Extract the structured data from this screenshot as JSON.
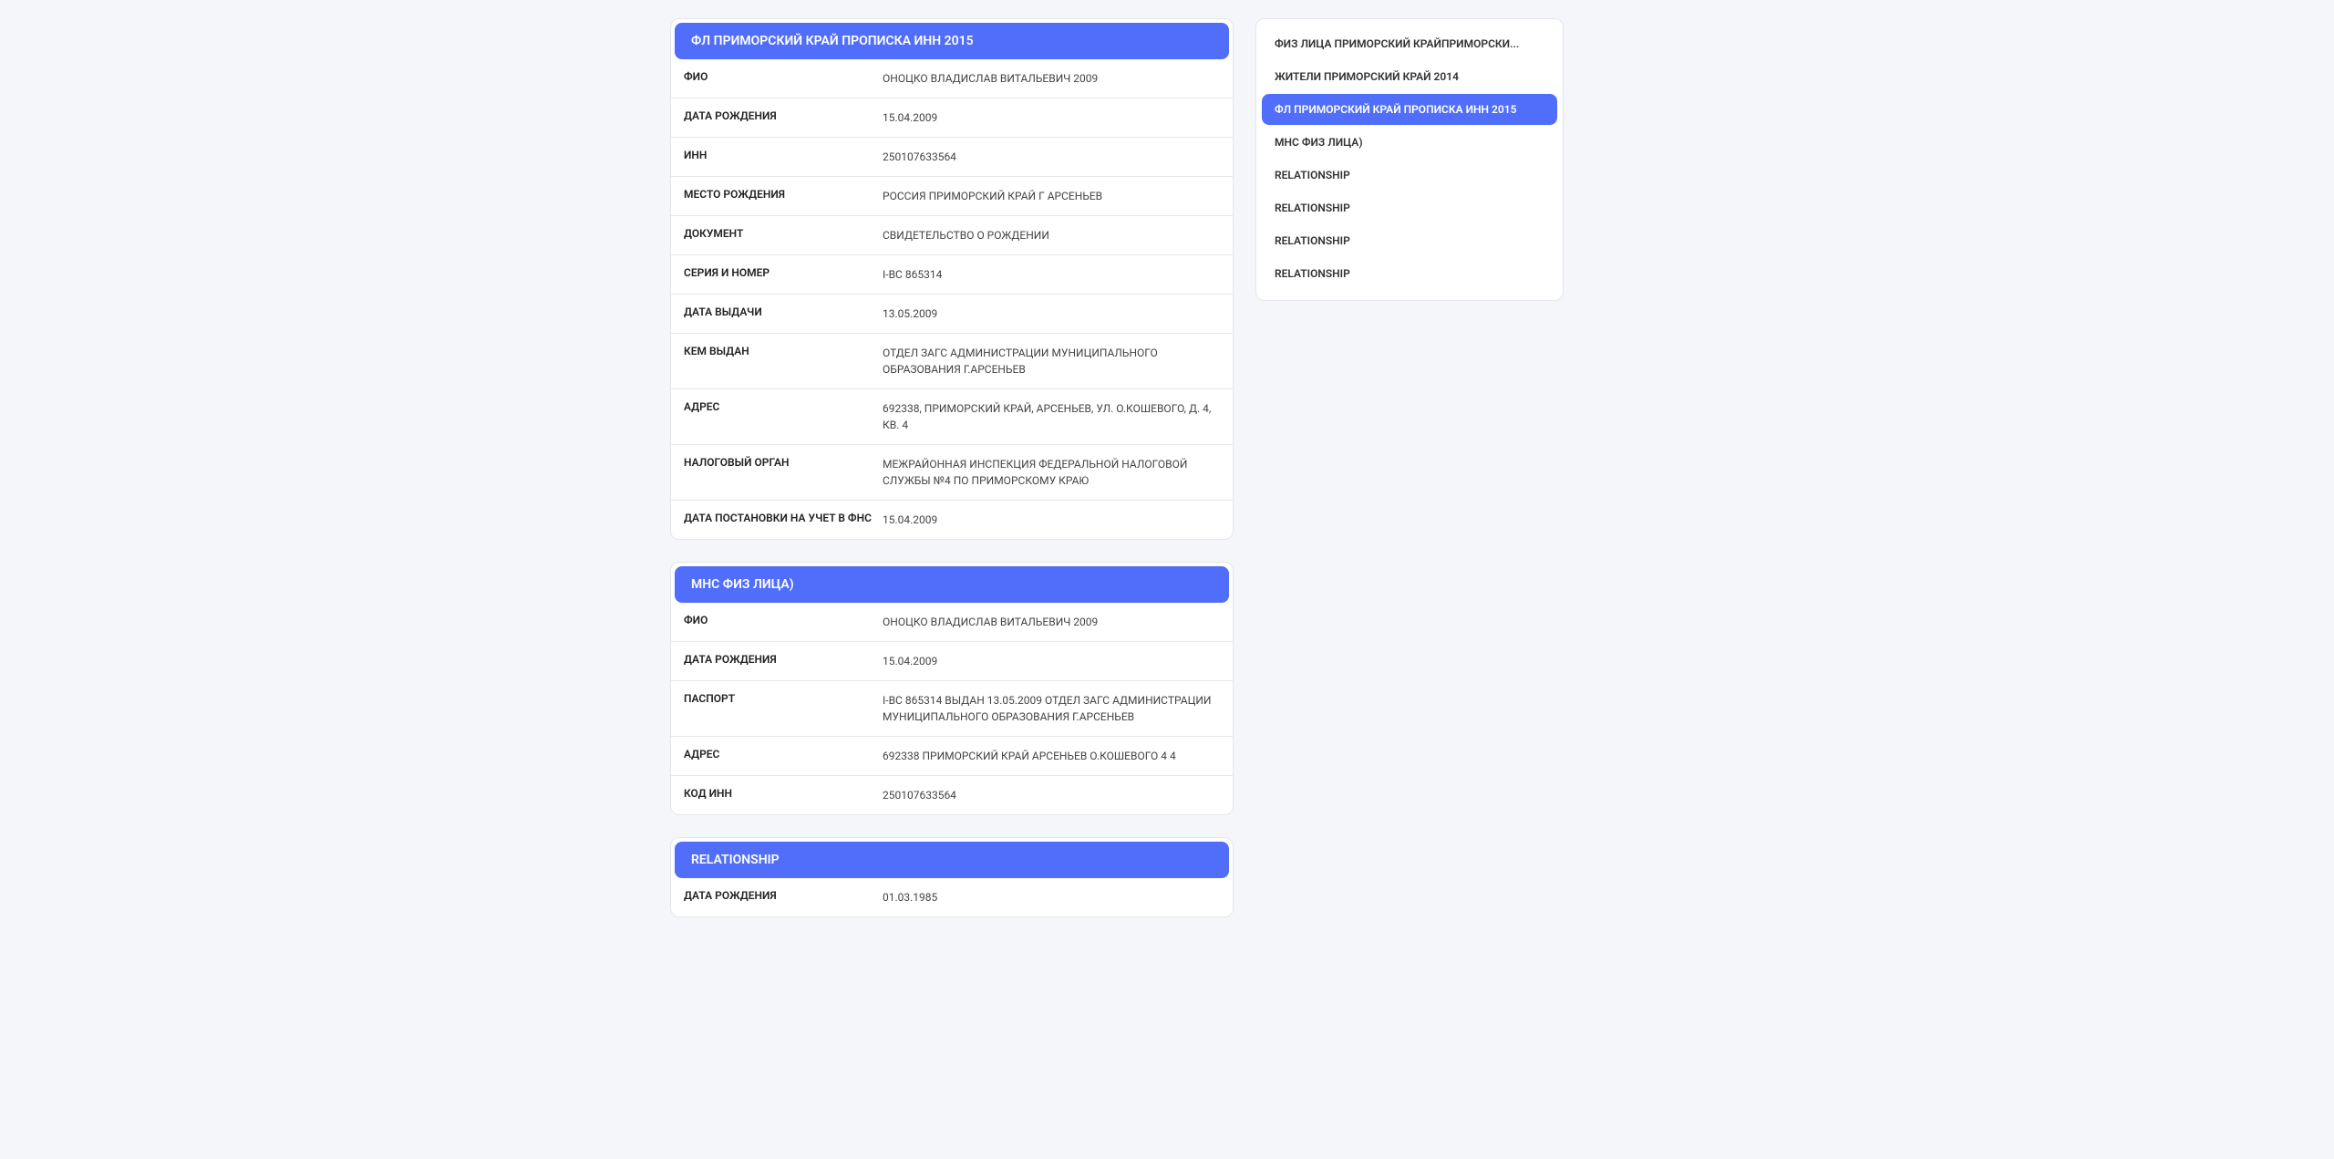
{
  "nav": {
    "items": [
      {
        "label": "ФИЗ ЛИЦА ПРИМОРСКИЙ КРАЙПРИМОРСКИ...",
        "active": false
      },
      {
        "label": "ЖИТЕЛИ ПРИМОРСКИЙ КРАЙ 2014",
        "active": false
      },
      {
        "label": "ФЛ ПРИМОРСКИЙ КРАЙ ПРОПИСКА ИНН 2015",
        "active": true
      },
      {
        "label": "МНС ФИЗ ЛИЦА)",
        "active": false
      },
      {
        "label": "RELATIONSHIP",
        "active": false
      },
      {
        "label": "RELATIONSHIP",
        "active": false
      },
      {
        "label": "RELATIONSHIP",
        "active": false
      },
      {
        "label": "RELATIONSHIP",
        "active": false
      }
    ]
  },
  "cards": [
    {
      "title": "ФЛ ПРИМОРСКИЙ КРАЙ ПРОПИСКА ИНН 2015",
      "rows": [
        {
          "label": "ФИО",
          "value": "ОНОЦКО ВЛАДИСЛАВ ВИТАЛЬЕВИЧ 2009"
        },
        {
          "label": "ДАТА РОЖДЕНИЯ",
          "value": "15.04.2009"
        },
        {
          "label": "ИНН",
          "value": "250107633564"
        },
        {
          "label": "МЕСТО РОЖДЕНИЯ",
          "value": "РОССИЯ ПРИМОРСКИЙ КРАЙ Г АРСЕНЬЕВ"
        },
        {
          "label": "ДОКУМЕНТ",
          "value": "СВИДЕТЕЛЬСТВО О РОЖДЕНИИ"
        },
        {
          "label": "СЕРИЯ И НОМЕР",
          "value": "I-ВС 865314"
        },
        {
          "label": "ДАТА ВЫДАЧИ",
          "value": "13.05.2009"
        },
        {
          "label": "КЕМ ВЫДАН",
          "value": "ОТДЕЛ ЗАГС АДМИНИСТРАЦИИ МУНИЦИПАЛЬНОГО ОБРАЗОВАНИЯ Г.АРСЕНЬЕВ"
        },
        {
          "label": "АДРЕС",
          "value": "692338, ПРИМОРСКИЙ КРАЙ, АРСЕНЬЕВ, УЛ. О.КОШЕВОГО, Д. 4, КВ. 4"
        },
        {
          "label": "НАЛОГОВЫЙ ОРГАН",
          "value": "МЕЖРАЙОННАЯ ИНСПЕКЦИЯ ФЕДЕРАЛЬНОЙ НАЛОГОВОЙ СЛУЖБЫ №4 ПО ПРИМОРСКОМУ КРАЮ"
        },
        {
          "label": "ДАТА ПОСТАНОВКИ НА УЧЕТ В ФНС",
          "value": "15.04.2009"
        }
      ]
    },
    {
      "title": "МНС ФИЗ ЛИЦА)",
      "rows": [
        {
          "label": "ФИО",
          "value": "ОНОЦКО ВЛАДИСЛАВ ВИТАЛЬЕВИЧ 2009"
        },
        {
          "label": "ДАТА РОЖДЕНИЯ",
          "value": "15.04.2009"
        },
        {
          "label": "ПАСПОРТ",
          "value": "I-ВС 865314 ВЫДАН 13.05.2009 ОТДЕЛ ЗАГС АДМИНИСТРАЦИИ МУНИЦИПАЛЬНОГО ОБРАЗОВАНИЯ Г.АРСЕНЬЕВ"
        },
        {
          "label": "АДРЕС",
          "value": "692338 ПРИМОРСКИЙ КРАЙ АРСЕНЬЕВ О.КОШЕВОГО 4 4"
        },
        {
          "label": "КОД ИНН",
          "value": "250107633564"
        }
      ]
    },
    {
      "title": "RELATIONSHIP",
      "rows": [
        {
          "label": "ДАТА РОЖДЕНИЯ",
          "value": "01.03.1985"
        }
      ]
    }
  ]
}
